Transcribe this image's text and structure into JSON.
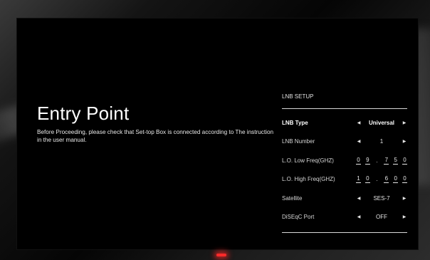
{
  "page": {
    "title": "Entry Point",
    "instructions": "Before Proceeding, please check that Set-top Box is connected according to The instruction in the user manual."
  },
  "panel": {
    "title": "LNB SETUP",
    "rows": [
      {
        "label": "LNB Type",
        "value": "Universal",
        "selected": true
      },
      {
        "label": "LNB Number",
        "value": "1"
      },
      {
        "label": "L.O. Low Freq(GHZ)",
        "digits": [
          "0",
          "9",
          "7",
          "5",
          "0"
        ]
      },
      {
        "label": "L.O. High Freq(GHZ)",
        "digits": [
          "1",
          "0",
          "6",
          "0",
          "0"
        ]
      },
      {
        "label": "Satellite",
        "value": "SES-7"
      },
      {
        "label": "DiSEqC Port",
        "value": "OFF"
      }
    ],
    "separator": "."
  },
  "icons": {
    "left_arrow": "◀",
    "right_arrow": "▶"
  },
  "colors": {
    "screen_bg": "#000000",
    "text": "#ffffff",
    "power_led": "#ff2a2a"
  }
}
